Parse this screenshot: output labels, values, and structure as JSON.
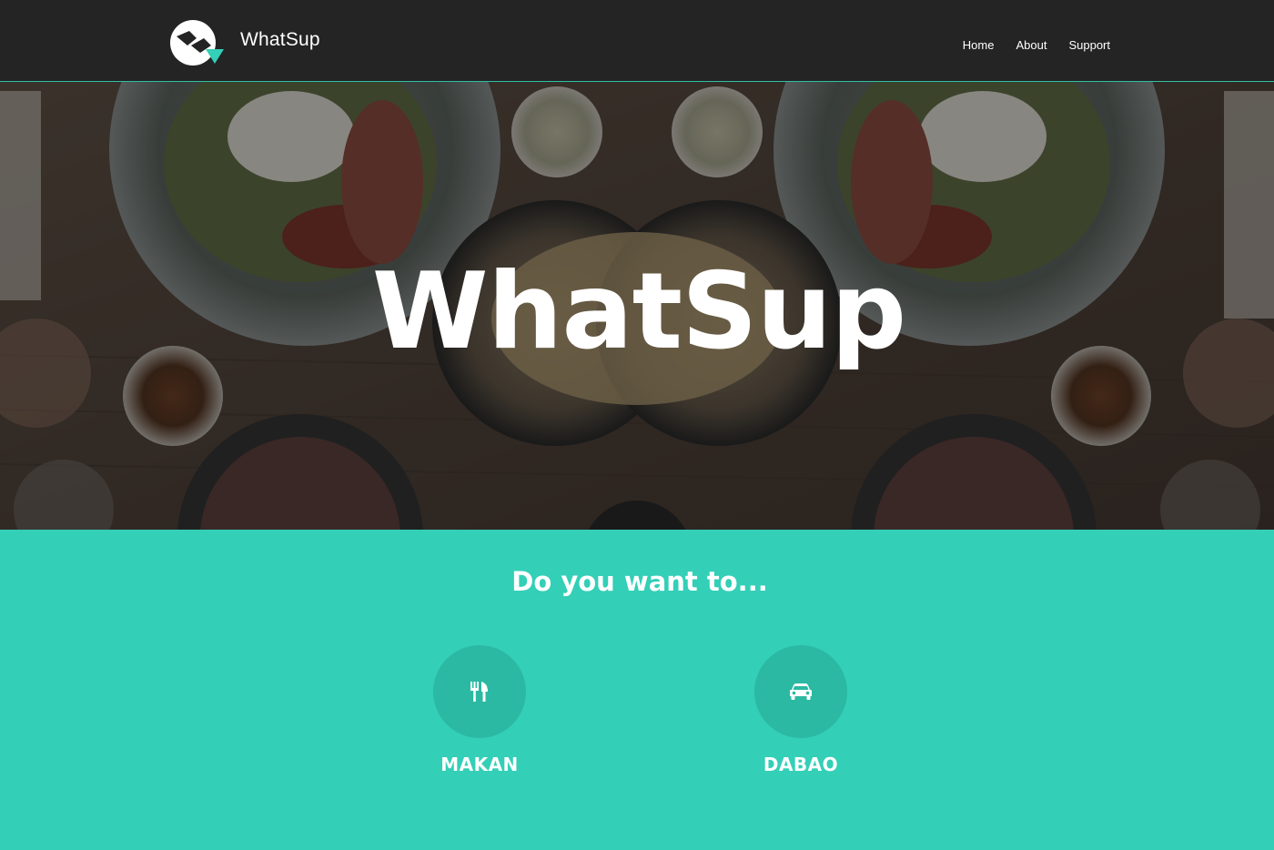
{
  "navbar": {
    "brand_name": "WhatSup",
    "links": [
      {
        "label": "Home"
      },
      {
        "label": "About"
      },
      {
        "label": "Support"
      }
    ]
  },
  "hero": {
    "title": "WhatSup"
  },
  "cta": {
    "question": "Do you want to...",
    "options": [
      {
        "label": "MAKAN",
        "icon": "fork-knife-icon"
      },
      {
        "label": "DABAO",
        "icon": "car-icon"
      }
    ]
  },
  "colors": {
    "navbar_bg": "#242424",
    "accent": "#33cfb7",
    "accent_dark": "#2bb9a3",
    "text": "#ffffff"
  }
}
